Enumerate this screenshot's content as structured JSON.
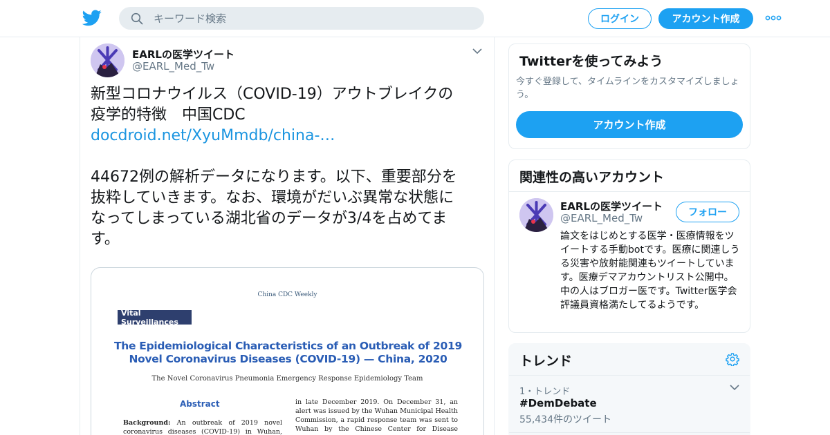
{
  "header": {
    "search_placeholder": "キーワード検索",
    "login_label": "ログイン",
    "signup_label": "アカウント作成"
  },
  "tweet": {
    "user_name": "EARLの医学ツイート",
    "user_handle": "@EARL_Med_Tw",
    "text_line1": "新型コロナウイルス（COVID-19）アウトブレイクの",
    "text_line2": "疫学的特徴　中国CDC",
    "link_text": "docdroid.net/XyuMmdb/china-…",
    "text_line3": "44672例の解析データになります。以下、重要部分を",
    "text_line4": "抜粋していきます。なお、環境がだいぶ異常な状態に",
    "text_line5": "なってしまっている湖北省のデータが3/4を占めてま",
    "text_line6": "す。"
  },
  "card": {
    "journal": "China CDC Weekly",
    "tag": "Vital Surveillances",
    "title": "The Epidemiological Characteristics of an Outbreak of 2019 Novel Coronavirus Diseases (COVID-19) — China, 2020",
    "team": "The Novel Coronavirus Pneumonia Emergency Response Epidemiology Team",
    "abstract_heading": "Abstract",
    "left_col_lead": "Background:",
    "left_col_text": " An outbreak of 2019 novel coronavirus diseases (COVID-19) in Wuhan, Hubei Province,",
    "right_col_text": "in late December 2019. On December 31, an alert was issued by the Wuhan Municipal Health Commission, a rapid response team was sent to Wuhan by the Chinese Center for Disease Control and Prevention"
  },
  "signup_module": {
    "title": "Twitterを使ってみよう",
    "description": "今すぐ登録して、タイムラインをカスタマイズしましょう。",
    "button_label": "アカウント作成"
  },
  "related_module": {
    "title": "関連性の高いアカウント",
    "account_name": "EARLの医学ツイート",
    "account_handle": "@EARL_Med_Tw",
    "follow_label": "フォロー",
    "bio": "論文をはじめとする医学・医療情報をツイートする手動botです。医療に関連しうる災害や放射能関連もツイートしています。医療デマアカウントリスト公開中。中の人はブロガー医です。Twitter医学会評議員資格満たしてるようです。"
  },
  "trends_module": {
    "title": "トレンド",
    "items": [
      {
        "rank": "1・トレンド",
        "hashtag": "#DemDebate",
        "count": "55,434件のツイート"
      }
    ]
  },
  "colors": {
    "brand_blue": "#1da1f2",
    "link_blue": "#1b95e0",
    "border": "#e6ecf0",
    "muted_text": "#657786"
  }
}
